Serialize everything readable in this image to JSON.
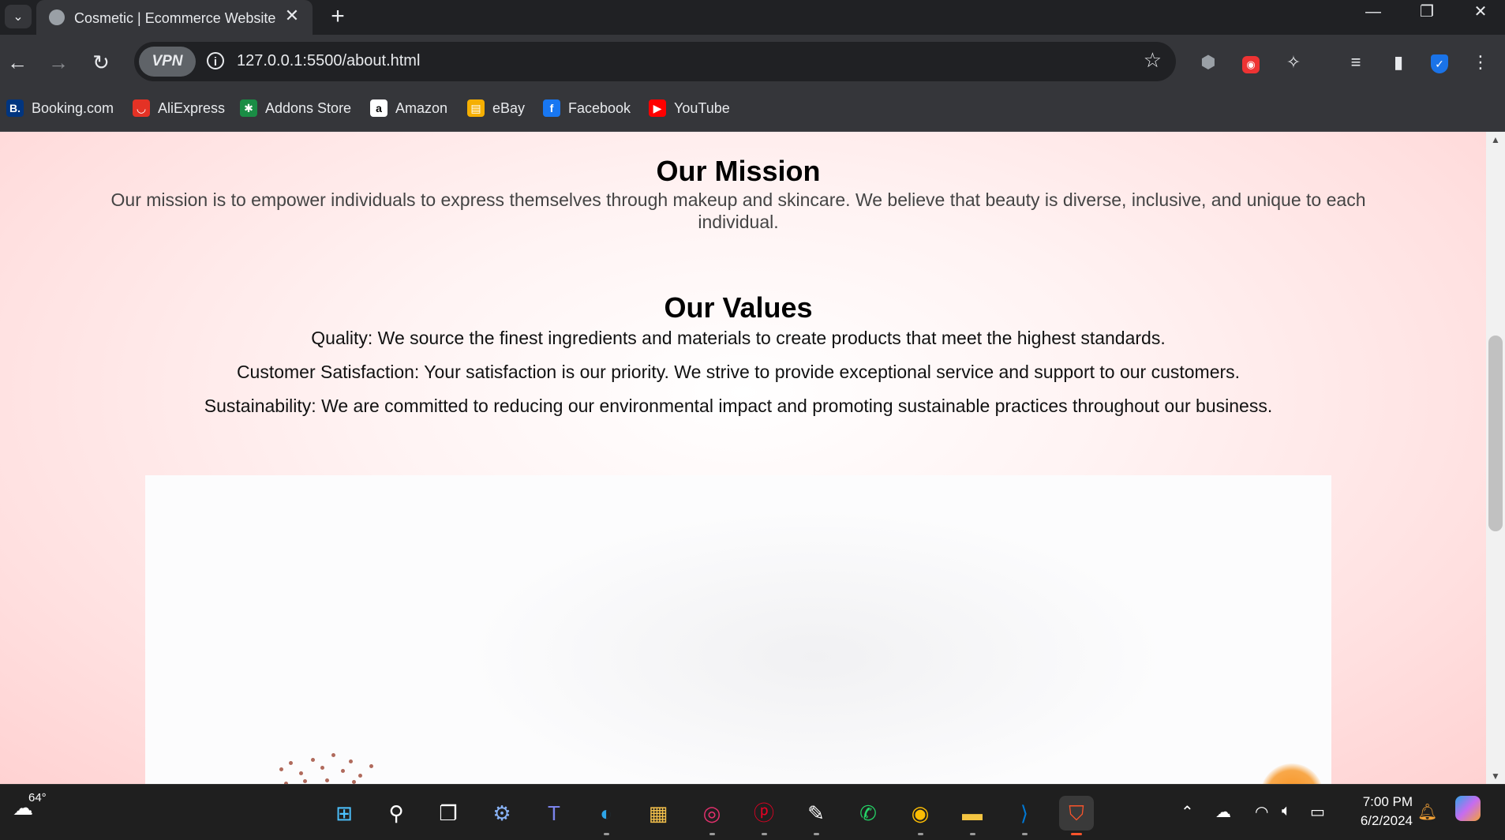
{
  "browser": {
    "tab": {
      "title": "Cosmetic | Ecommerce Website"
    },
    "toolbar": {
      "vpn_label": "VPN",
      "url": "127.0.0.1:5500/about.html"
    },
    "bookmarks": [
      {
        "label": "Booking.com",
        "icon": "booking-icon",
        "color": "#003580",
        "glyph": "B."
      },
      {
        "label": "AliExpress",
        "icon": "aliexpress-icon",
        "color": "#e43225",
        "glyph": "◡"
      },
      {
        "label": "Addons Store",
        "icon": "addons-store-icon",
        "color": "#1a8d45",
        "glyph": "✱"
      },
      {
        "label": "Amazon",
        "icon": "amazon-icon",
        "color": "#ffffff",
        "glyph": "a"
      },
      {
        "label": "eBay",
        "icon": "ebay-icon",
        "color": "#f5af02",
        "glyph": "▤"
      },
      {
        "label": "Facebook",
        "icon": "facebook-icon",
        "color": "#1877f2",
        "glyph": "f"
      },
      {
        "label": "YouTube",
        "icon": "youtube-icon",
        "color": "#ff0000",
        "glyph": "▶"
      }
    ]
  },
  "page": {
    "mission": {
      "title": "Our Mission",
      "text": "Our mission is to empower individuals to express themselves through makeup and skincare. We believe that beauty is diverse, inclusive, and unique to each individual."
    },
    "values": {
      "title": "Our Values",
      "items": [
        "Quality: We source the finest ingredients and materials to create products that meet the highest standards.",
        "Customer Satisfaction: Your satisfaction is our priority. We strive to provide exceptional service and support to our customers.",
        "Sustainability: We are committed to reducing our environmental impact and promoting sustainable practices throughout our business."
      ]
    }
  },
  "taskbar": {
    "weather": "64°",
    "time": "7:00 PM",
    "date": "6/2/2024"
  },
  "colors": {
    "page_background": "#ffe0e0",
    "browser_dark": "#202124",
    "browser_toolbar": "#35363a"
  }
}
